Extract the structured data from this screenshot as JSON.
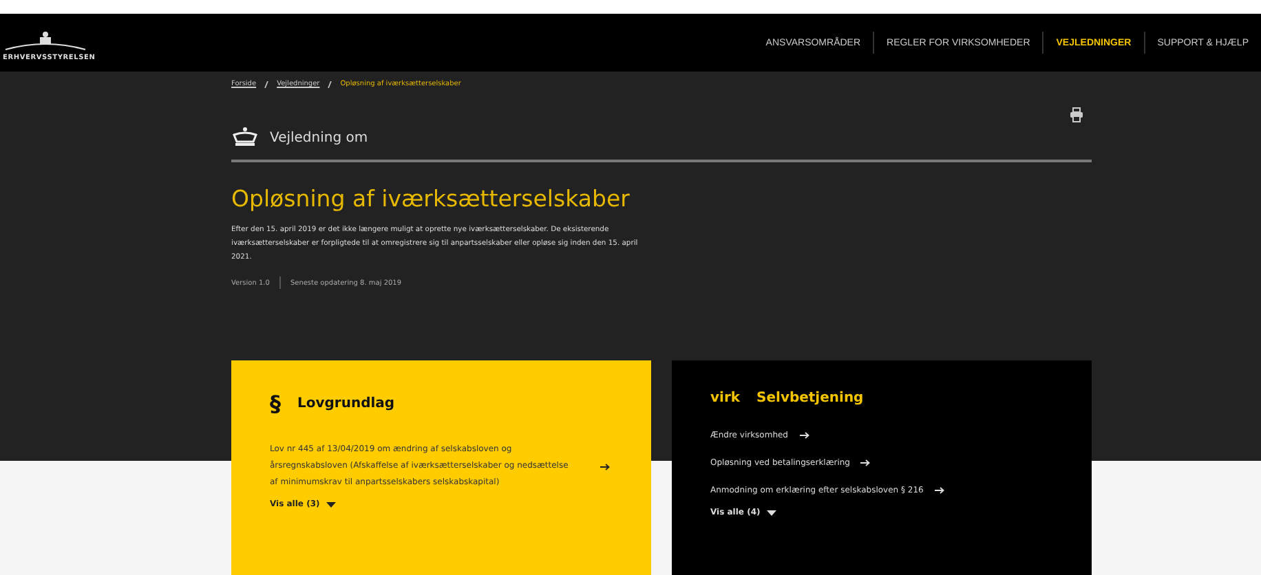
{
  "logo": {
    "text": "ERHVERVSSTYRELSEN"
  },
  "nav": [
    {
      "label": "ANSVARSOMRÅDER",
      "selected": false
    },
    {
      "label": "REGLER FOR VIRKSOMHEDER",
      "selected": false
    },
    {
      "label": "VEJLEDNINGER",
      "selected": true
    },
    {
      "label": "SUPPORT & HJÆLP",
      "selected": false
    }
  ],
  "breadcrumb": [
    {
      "label": "Forside",
      "current": false
    },
    {
      "label": "Vejledninger",
      "current": false
    },
    {
      "label": "Opløsning af iværksætterselskaber",
      "current": true
    }
  ],
  "guide_label": "Vejledning om",
  "title": "Opløsning af iværksætterselskaber",
  "intro": "Efter den 15. april 2019 er det ikke længere muligt at oprette nye iværksætterselskaber. De eksisterende iværksætterselskaber er forpligtede til at omregistrere sig til anpartsselskaber eller opløse sig inden den 15. april 2021.",
  "version": "Version 1.0",
  "updated": "Seneste opdatering 8. maj 2019",
  "cards": [
    {
      "kind": "law",
      "icon": "§",
      "title": "Lovgrundlag",
      "links": [
        "Lov nr 445 af 13/04/2019 om ændring af selskabsloven og årsregnskabsloven (Afskaffelse af iværksætterselskaber og nedsættelse af minimumskrav til anpartsselskabers selskabskapital)"
      ],
      "show_all": "Vis alle (3)"
    },
    {
      "kind": "selfservice",
      "icon": "virk",
      "title": "Selvbetjening",
      "links": [
        "Ændre virksomhed",
        "Opløsning ved betalingserklæring",
        "Anmodning om erklæring efter selskabsloven § 216"
      ],
      "show_all": "Vis alle (4)"
    }
  ]
}
